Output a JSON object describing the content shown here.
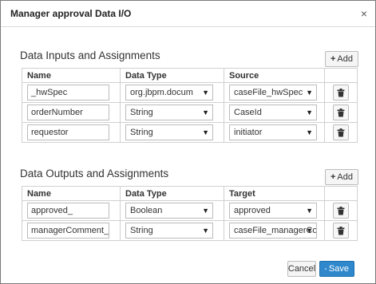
{
  "dialog": {
    "title": "Manager approval Data I/O",
    "close_icon": "×"
  },
  "inputs": {
    "title": "Data Inputs and Assignments",
    "add_label": "Add",
    "columns": [
      "Name",
      "Data Type",
      "Source"
    ],
    "rows": [
      {
        "name": "_hwSpec",
        "type": "org.jbpm.docum",
        "value": "caseFile_hwSpec"
      },
      {
        "name": "orderNumber",
        "type": "String",
        "value": "CaseId"
      },
      {
        "name": "requestor",
        "type": "String",
        "value": "initiator"
      }
    ]
  },
  "outputs": {
    "title": "Data Outputs and Assignments",
    "add_label": "Add",
    "columns": [
      "Name",
      "Data Type",
      "Target"
    ],
    "rows": [
      {
        "name": "approved_",
        "type": "Boolean",
        "value": "approved"
      },
      {
        "name": "managerComment_",
        "type": "String",
        "value": "caseFile_managerComment"
      }
    ]
  },
  "footer": {
    "cancel_label": "Cancel",
    "save_label": "Save"
  },
  "icons": {
    "add": "plus-icon",
    "delete": "trash-icon",
    "save": "floppy-disk-icon",
    "dropdown": "caret-down-icon"
  },
  "colors": {
    "primary": "#2f88cc",
    "border": "#d0d0d0"
  }
}
